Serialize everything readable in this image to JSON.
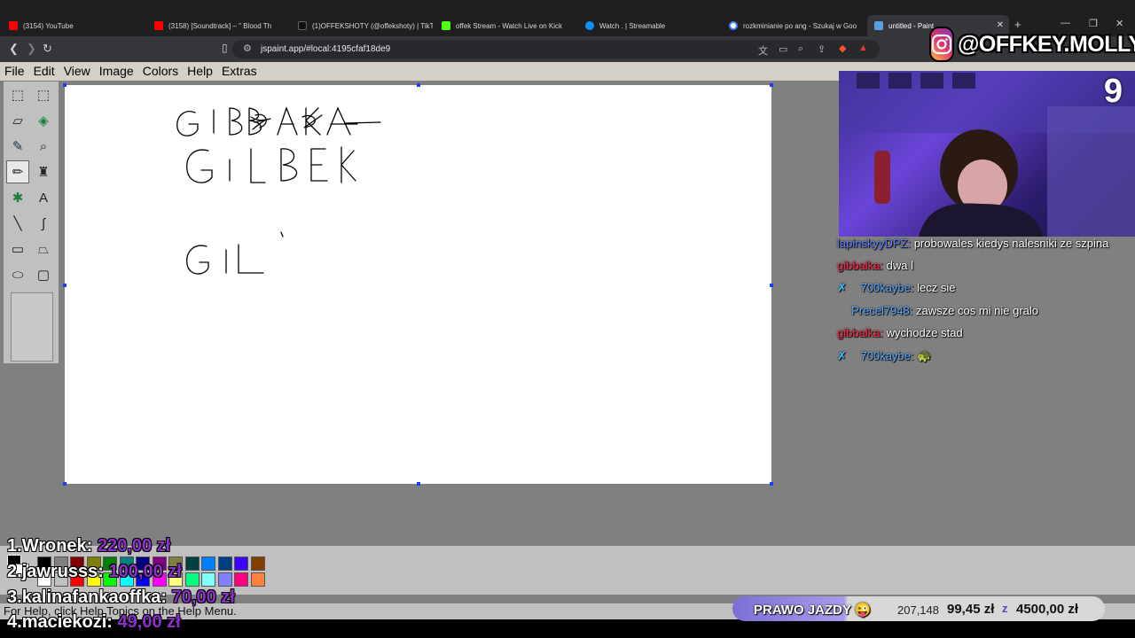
{
  "browser": {
    "tabs": [
      {
        "title": "(3154) YouTube",
        "color": "#ff0000"
      },
      {
        "title": "(3158) [Soundtrack] – \" Blood Th",
        "color": "#ff0000"
      },
      {
        "title": "(1)OFFEKSHOTY (@offekshoty) | TikT",
        "color": "#111111"
      },
      {
        "title": "offek Stream - Watch Live on Kick",
        "color": "#53fc18"
      },
      {
        "title": "Watch . | Streamable",
        "color": "#0f90fa"
      },
      {
        "title": "rozkminianie po ang - Szukaj w Goo",
        "color": "#4285f4"
      },
      {
        "title": "untitled - Paint",
        "color": "#5aa0e0"
      }
    ],
    "url": "jspaint.app/#local:4195cfaf18de9"
  },
  "paint": {
    "menu": [
      "File",
      "Edit",
      "View",
      "Image",
      "Colors",
      "Help",
      "Extras"
    ],
    "tools": [
      {
        "name": "free-form-select-tool",
        "glyph": "⬚"
      },
      {
        "name": "select-tool",
        "glyph": "⬚"
      },
      {
        "name": "eraser-tool",
        "glyph": "▱"
      },
      {
        "name": "fill-tool",
        "glyph": "◈"
      },
      {
        "name": "pick-color-tool",
        "glyph": "✎"
      },
      {
        "name": "magnifier-tool",
        "glyph": "⌕"
      },
      {
        "name": "pencil-tool",
        "glyph": "✏"
      },
      {
        "name": "brush-tool",
        "glyph": "♜"
      },
      {
        "name": "airbrush-tool",
        "glyph": "✱"
      },
      {
        "name": "text-tool",
        "glyph": "A"
      },
      {
        "name": "line-tool",
        "glyph": "╲"
      },
      {
        "name": "curve-tool",
        "glyph": "∫"
      },
      {
        "name": "rectangle-tool",
        "glyph": "▭"
      },
      {
        "name": "polygon-tool",
        "glyph": "⏢"
      },
      {
        "name": "ellipse-tool",
        "glyph": "⬭"
      },
      {
        "name": "rounded-rectangle-tool",
        "glyph": "▢"
      }
    ],
    "palette": [
      "#000000",
      "#808080",
      "#800000",
      "#808000",
      "#008000",
      "#008080",
      "#000080",
      "#800080",
      "#808040",
      "#004040",
      "#0080ff",
      "#004080",
      "#4000ff",
      "#804000",
      "#ffffff",
      "#c0c0c0",
      "#ff0000",
      "#ffff00",
      "#00ff00",
      "#00ffff",
      "#0000ff",
      "#ff00ff",
      "#ffff80",
      "#00ff80",
      "#80ffff",
      "#8080ff",
      "#ff0080",
      "#ff8040"
    ],
    "status": "For Help, click Help Topics on the Help Menu."
  },
  "overlay": {
    "instagram": "@OFFKEY.MOLLY",
    "cam_counter": "9",
    "chat": [
      {
        "user": "lapinskyyDPZ:",
        "user_color": "#5b7cff",
        "message": "probowales kiedys nalesniki ze szpina"
      },
      {
        "user": "gibbalka:",
        "user_color": "#ff2a4a",
        "message": "dwa l"
      },
      {
        "user": "700kaybe:",
        "user_color": "#5da9ff",
        "message": "lecz sie"
      },
      {
        "user": "Precel7948:",
        "user_color": "#5da9ff",
        "message": "zawsze cos mi nie gralo"
      },
      {
        "user": "gibbalka:",
        "user_color": "#ff2a4a",
        "message": "wychodze stad"
      },
      {
        "user": "700kaybe:",
        "user_color": "#5da9ff",
        "message": "🐢"
      }
    ],
    "donations": [
      {
        "rank": "1.",
        "name": "Wronek:",
        "amount": "220,00 zł"
      },
      {
        "rank": "2.",
        "name": "jawrusss:",
        "amount": "100,00 zł"
      },
      {
        "rank": "3.",
        "name": "kalinafankaoffka:",
        "amount": "70,00 zł"
      },
      {
        "rank": "4.",
        "name": "maciekozi:",
        "amount": "49,00 zł"
      }
    ],
    "goal": {
      "title": "PRAWO JAZDY 😜",
      "views": "207,148",
      "current": "99,45 zł",
      "target": "4500,00 zł"
    }
  }
}
